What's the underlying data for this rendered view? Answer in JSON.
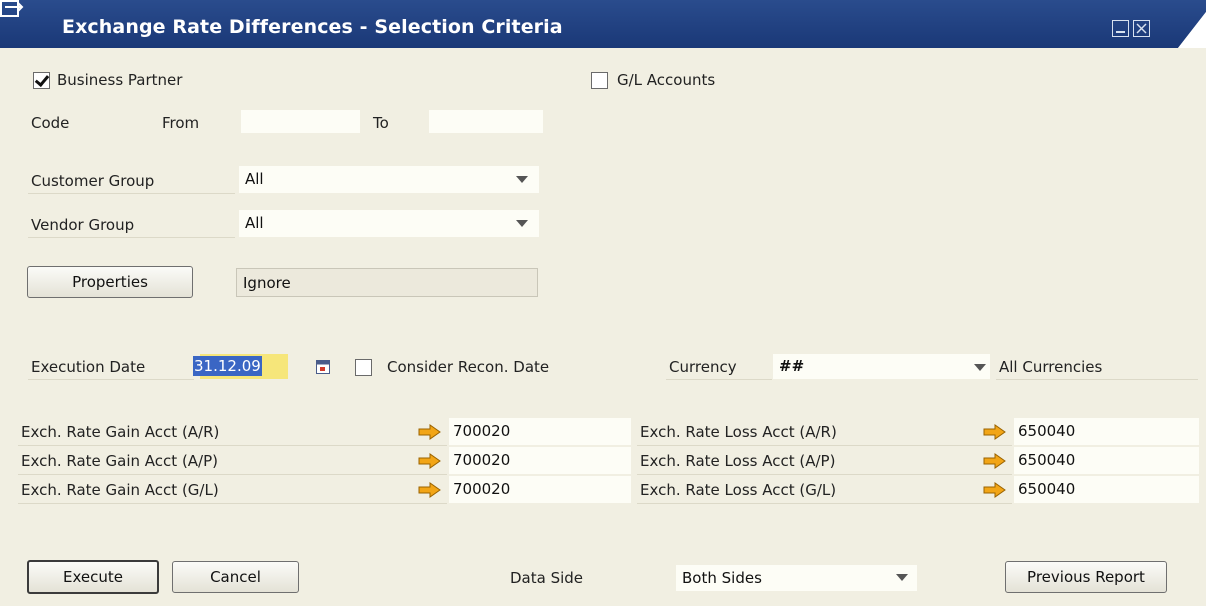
{
  "window": {
    "title": "Exchange Rate Differences - Selection Criteria",
    "icon": "window-icon",
    "controls": [
      "minimize-icon",
      "close-icon"
    ],
    "colors": {
      "titlebar": "#1f3f7f",
      "body": "#f1efe2",
      "accent_arrow": "#f2a516"
    }
  },
  "business_partner": {
    "label": "Business Partner",
    "checked": true,
    "code_label": "Code",
    "from_label": "From",
    "to_label": "To",
    "from_value": "",
    "to_value": ""
  },
  "gl_accounts": {
    "label": "G/L Accounts",
    "checked": false
  },
  "customer_group": {
    "label": "Customer Group",
    "value": "All"
  },
  "vendor_group": {
    "label": "Vendor Group",
    "value": "All"
  },
  "properties": {
    "button_label": "Properties",
    "value": "Ignore"
  },
  "execution": {
    "date_label": "Execution Date",
    "date_value": "31.12.09",
    "consider_recon_label": "Consider Recon. Date",
    "consider_recon_checked": false,
    "currency_label": "Currency",
    "currency_value": "##",
    "currency_desc": "All Currencies"
  },
  "accounts": [
    {
      "gain_label": "Exch. Rate Gain Acct (A/R)",
      "gain_value": "700020",
      "loss_label": "Exch. Rate Loss Acct (A/R)",
      "loss_value": "650040"
    },
    {
      "gain_label": "Exch. Rate Gain Acct (A/P)",
      "gain_value": "700020",
      "loss_label": "Exch. Rate Loss Acct (A/P)",
      "loss_value": "650040"
    },
    {
      "gain_label": "Exch. Rate Gain Acct (G/L)",
      "gain_value": "700020",
      "loss_label": "Exch. Rate Loss Acct (G/L)",
      "loss_value": "650040"
    }
  ],
  "footer": {
    "execute_label": "Execute",
    "cancel_label": "Cancel",
    "data_side_label": "Data Side",
    "data_side_value": "Both Sides",
    "previous_report_label": "Previous Report"
  }
}
